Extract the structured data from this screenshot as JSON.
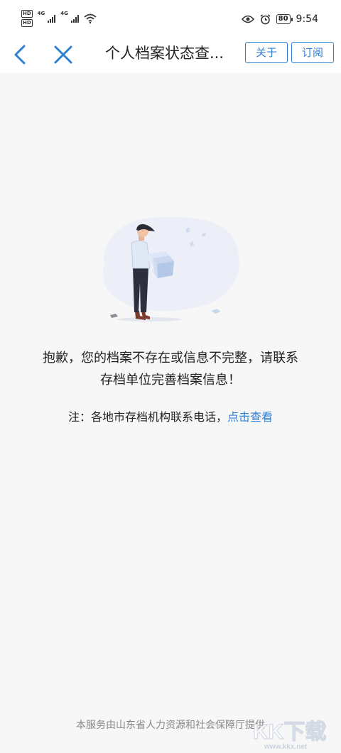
{
  "status_bar": {
    "hd_badge_1": "HD",
    "hd_badge_2": "HD",
    "network_1": "4G",
    "network_2": "4G",
    "battery": "80",
    "time": "9:54"
  },
  "nav": {
    "title": "个人档案状态查...",
    "about_label": "关于",
    "subscribe_label": "订阅"
  },
  "content": {
    "message_line1": "抱歉，您的档案不存在或信息不完整，请联系",
    "message_line2": "存档单位完善档案信息！",
    "note_prefix": "注：各地市存档机构联系电话，",
    "note_link": "点击查看"
  },
  "footer": {
    "text": "本服务由山东省人力资源和社会保障厅提供"
  },
  "watermark": {
    "brand": "KK下载",
    "url": "www.kkx.net"
  },
  "colors": {
    "accent": "#2f7fd3",
    "background": "#f7f7f7"
  }
}
